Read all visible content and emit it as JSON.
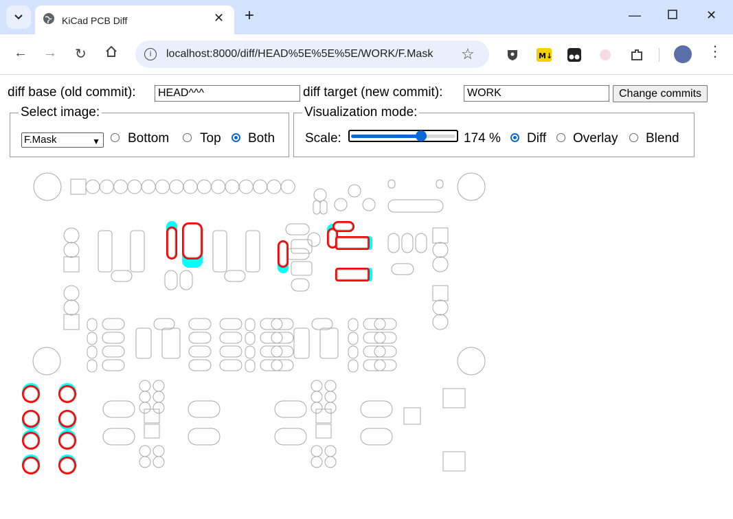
{
  "browser": {
    "tab_title": "KiCad PCB Diff",
    "url": "localhost:8000/diff/HEAD%5E%5E%5E/WORK/F.Mask"
  },
  "form": {
    "base_label": "diff base (old commit):",
    "base_value": "HEAD^^^",
    "target_label": "diff target (new commit):",
    "target_value": "WORK",
    "change_button": "Change commits"
  },
  "select_image": {
    "legend": "Select image:",
    "selected_layer": "F.Mask",
    "options": [
      {
        "label": "Bottom",
        "selected": false
      },
      {
        "label": "Top",
        "selected": false
      },
      {
        "label": "Both",
        "selected": true
      }
    ]
  },
  "visualization": {
    "legend": "Visualization mode:",
    "scale_label": "Scale:",
    "scale_value": 174,
    "scale_min": 10,
    "scale_max": 500,
    "scale_text": "174 %",
    "modes": [
      {
        "label": "Diff",
        "selected": true
      },
      {
        "label": "Overlay",
        "selected": false
      },
      {
        "label": "Blend",
        "selected": false
      }
    ]
  },
  "colors": {
    "removed": "#ff0000",
    "added": "#00ffff",
    "outline": "#a8a8a8",
    "accent": "#0b69d6",
    "chrome_top": "#d3e3fd"
  },
  "icons": [
    "tab-list-icon",
    "globe-icon",
    "close-icon",
    "plus-icon",
    "minimize-icon",
    "maximize-icon",
    "window-close-icon",
    "back-arrow-icon",
    "forward-arrow-icon",
    "reload-icon",
    "home-icon",
    "info-icon",
    "star-icon",
    "extensions-icon",
    "menu-icon"
  ]
}
